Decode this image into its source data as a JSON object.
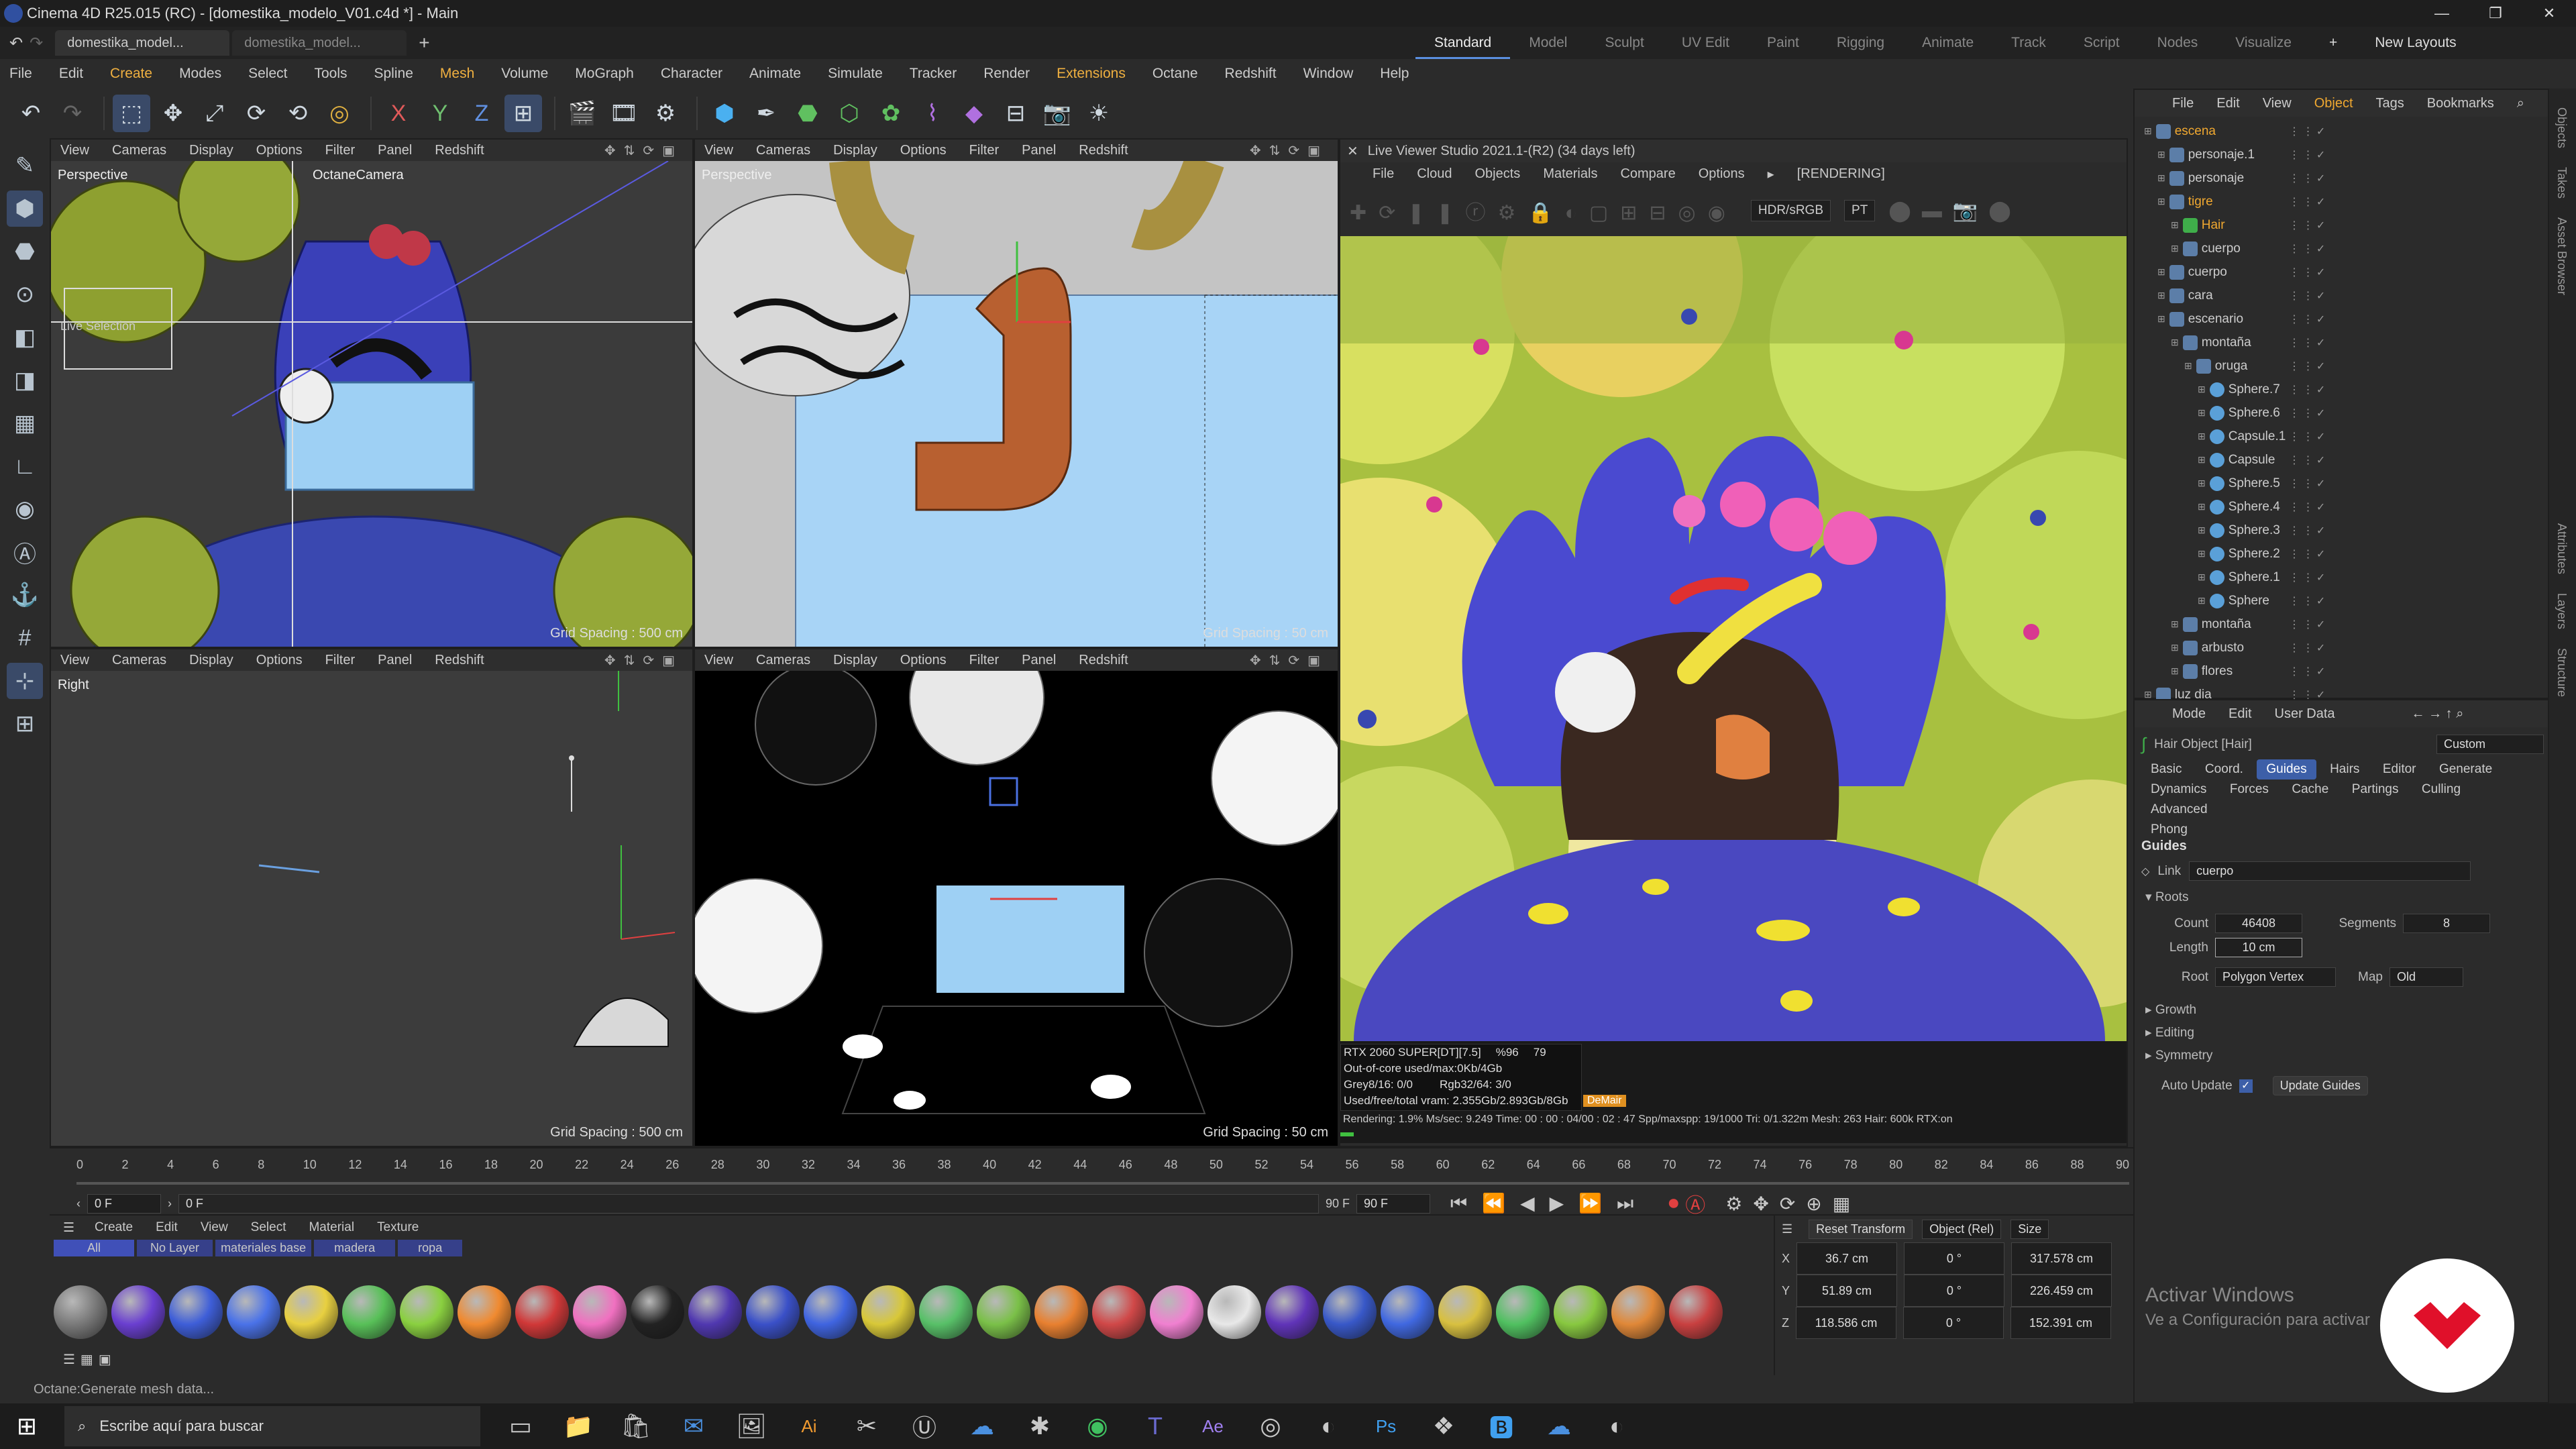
{
  "window": {
    "title": "Cinema 4D R25.015 (RC) - [domestika_modelo_V01.c4d *] - Main",
    "controls": [
      "—",
      "❐",
      "✕"
    ]
  },
  "tabs": {
    "doc1": "domestika_model...",
    "doc2": "domestika_model...",
    "add": "+",
    "layouts": [
      "Standard",
      "Model",
      "Sculpt",
      "UV Edit",
      "Paint",
      "Rigging",
      "Animate",
      "Track",
      "Script",
      "Nodes",
      "Visualize"
    ],
    "new_layouts": "New Layouts"
  },
  "menu": [
    "File",
    "Edit",
    "Create",
    "Modes",
    "Select",
    "Tools",
    "Spline",
    "Mesh",
    "Volume",
    "MoGraph",
    "Character",
    "Animate",
    "Simulate",
    "Tracker",
    "Render",
    "Extensions",
    "Octane",
    "Redshift",
    "Window",
    "Help"
  ],
  "viewports": {
    "menu": [
      "View",
      "Cameras",
      "Display",
      "Options",
      "Filter",
      "Panel",
      "Redshift"
    ],
    "tl": {
      "name": "Perspective",
      "camera": "OctaneCamera",
      "grid": "Grid Spacing : 500 cm",
      "tag": "Live Selection"
    },
    "tr": {
      "name": "Perspective",
      "grid": "Grid Spacing : 50 cm"
    },
    "bl": {
      "name": "Right",
      "grid": "Grid Spacing : 500 cm"
    },
    "br": {
      "grid": "Grid Spacing : 50 cm"
    }
  },
  "live_viewer": {
    "title": "Live Viewer Studio 2021.1-(R2) (34 days left)",
    "menu": [
      "File",
      "Cloud",
      "Objects",
      "Materials",
      "Compare",
      "Options"
    ],
    "status": "[RENDERING]",
    "colorspace": "HDR/sRGB",
    "mode": "PT",
    "stats": {
      "gpu": "RTX 2060 SUPER[DT][7.5]",
      "gpu_pct": "%96",
      "gpu_temp": "79",
      "outofcore": "Out-of-core used/max:0Kb/4Gb",
      "grey": "Grey8/16: 0/0",
      "rgb": "Rgb32/64: 3/0",
      "vram": "Used/free/total vram: 2.355Gb/2.893Gb/8Gb",
      "denoise": "DeMair",
      "line": "Rendering: 1.9%  Ms/sec: 9.249  Time: 00 : 00 : 04/00 : 02 : 47  Spp/maxspp: 19/1000  Tri: 0/1.322m  Mesh: 263  Hair: 600k  RTX:on"
    }
  },
  "object_manager": {
    "menu": [
      "File",
      "Edit",
      "View",
      "Object",
      "Tags",
      "Bookmarks"
    ],
    "items": [
      {
        "name": "escena",
        "indent": 0,
        "color": "orange",
        "icon": "layer"
      },
      {
        "name": "personaje.1",
        "indent": 1,
        "icon": "null"
      },
      {
        "name": "personaje",
        "indent": 1,
        "icon": "null"
      },
      {
        "name": "tigre",
        "indent": 1,
        "color": "orange",
        "icon": "null"
      },
      {
        "name": "Hair",
        "indent": 2,
        "color": "orange",
        "icon": "hair"
      },
      {
        "name": "cuerpo",
        "indent": 2,
        "icon": "mesh"
      },
      {
        "name": "cuerpo",
        "indent": 1,
        "icon": "null"
      },
      {
        "name": "cara",
        "indent": 1,
        "icon": "null"
      },
      {
        "name": "escenario",
        "indent": 1,
        "icon": "null"
      },
      {
        "name": "montaña",
        "indent": 2,
        "icon": "null"
      },
      {
        "name": "oruga",
        "indent": 3,
        "icon": "null"
      },
      {
        "name": "Sphere.7",
        "indent": 4,
        "icon": "sphere"
      },
      {
        "name": "Sphere.6",
        "indent": 4,
        "icon": "sphere"
      },
      {
        "name": "Capsule.1",
        "indent": 4,
        "icon": "sphere"
      },
      {
        "name": "Capsule",
        "indent": 4,
        "icon": "sphere"
      },
      {
        "name": "Sphere.5",
        "indent": 4,
        "icon": "sphere"
      },
      {
        "name": "Sphere.4",
        "indent": 4,
        "icon": "sphere"
      },
      {
        "name": "Sphere.3",
        "indent": 4,
        "icon": "sphere"
      },
      {
        "name": "Sphere.2",
        "indent": 4,
        "icon": "sphere"
      },
      {
        "name": "Sphere.1",
        "indent": 4,
        "icon": "sphere"
      },
      {
        "name": "Sphere",
        "indent": 4,
        "icon": "sphere"
      },
      {
        "name": "montaña",
        "indent": 2,
        "icon": "null"
      },
      {
        "name": "arbusto",
        "indent": 2,
        "icon": "null"
      },
      {
        "name": "flores",
        "indent": 2,
        "icon": "null"
      },
      {
        "name": "luz dia",
        "indent": 0,
        "icon": "null"
      }
    ]
  },
  "attributes": {
    "menu": [
      "Mode",
      "Edit",
      "User Data"
    ],
    "object": "Hair Object [Hair]",
    "preset": "Custom",
    "tabs_row1": [
      "Basic",
      "Coord.",
      "Guides",
      "Hairs",
      "Editor",
      "Generate"
    ],
    "tabs_row2": [
      "Dynamics",
      "Forces",
      "Cache",
      "Partings",
      "Culling",
      "Advanced"
    ],
    "tabs_row3": [
      "Phong"
    ],
    "active_tab": "Guides",
    "section": "Guides",
    "link_label": "Link",
    "link_value": "cuerpo",
    "roots": "Roots",
    "count_label": "Count",
    "count": "46408",
    "segments_label": "Segments",
    "segments": "8",
    "length_label": "Length",
    "length": "10 cm",
    "root_label": "Root",
    "root": "Polygon Vertex",
    "map_label": "Map",
    "map": "Old",
    "growth": "Growth",
    "editing": "Editing",
    "symmetry": "Symmetry",
    "auto_update": "Auto Update",
    "update_guides": "Update Guides"
  },
  "timeline": {
    "ticks": [
      "0",
      "2",
      "4",
      "6",
      "8",
      "10",
      "12",
      "14",
      "16",
      "18",
      "20",
      "22",
      "24",
      "26",
      "28",
      "30",
      "32",
      "34",
      "36",
      "38",
      "40",
      "42",
      "44",
      "46",
      "48",
      "50",
      "52",
      "54",
      "56",
      "58",
      "60",
      "62",
      "64",
      "66",
      "68",
      "70",
      "72",
      "74",
      "76",
      "78",
      "80",
      "82",
      "84",
      "86",
      "88",
      "90"
    ],
    "current": "0 F",
    "start": "0 F",
    "end": "90 F",
    "end2": "90 F"
  },
  "materials": {
    "menu": [
      "Create",
      "Edit",
      "View",
      "Select",
      "Material",
      "Texture"
    ],
    "filters": [
      "All",
      "No Layer",
      "materiales base",
      "madera",
      "ropa"
    ],
    "swatches": [
      "#7a7a7a",
      "#6a3fd0",
      "#3e5ed8",
      "#4a72e8",
      "#e8d040",
      "#58c058",
      "#8ad040",
      "#f08a30",
      "#d03838",
      "#f070c0",
      "#222222",
      "#5038b0",
      "#3a50c8",
      "#3f64e0",
      "#d8c838",
      "#58c068",
      "#7ac048",
      "#e88030",
      "#d04848",
      "#f080d0",
      "#e8e8e8",
      "#6034b8",
      "#3858c8",
      "#4068e0",
      "#d8c040",
      "#50c060",
      "#88c840",
      "#e08838",
      "#c84040"
    ]
  },
  "coords": {
    "reset": "Reset Transform",
    "mode": "Object (Rel)",
    "size": "Size",
    "x": "36.7 cm",
    "y": "51.89 cm",
    "z": "118.586 cm",
    "rx": "0 °",
    "ry": "0 °",
    "rz": "0 °",
    "sx": "317.578 cm",
    "sy": "226.459 cm",
    "sz": "152.391 cm"
  },
  "status": "Octane:Generate mesh data...",
  "watermark": {
    "line1": "Activar Windows",
    "line2": "Ve a Configuración para activar"
  },
  "taskbar": {
    "search": "Escribe aquí para buscar"
  },
  "side_tabs": [
    "Objects",
    "Takes",
    "Asset Browser",
    "Attributes",
    "Layers",
    "Structure"
  ]
}
